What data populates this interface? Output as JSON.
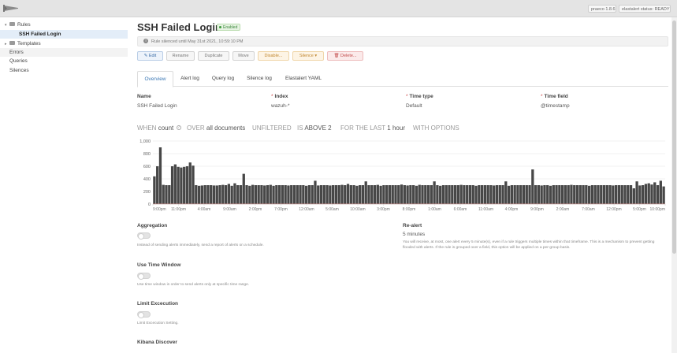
{
  "app": {
    "version_badge": "praeco 1.8.6",
    "status_badge": "elastalert status: READY"
  },
  "sidebar": {
    "items": [
      {
        "label": "Rules",
        "type": "folder",
        "expanded": true
      },
      {
        "label": "SSH Failed Login",
        "type": "rule",
        "selected": true
      },
      {
        "label": "Templates",
        "type": "folder",
        "expanded": false
      },
      {
        "label": "Errors",
        "type": "link"
      },
      {
        "label": "Queries",
        "type": "link"
      },
      {
        "label": "Silences",
        "type": "link"
      }
    ]
  },
  "rule": {
    "title": "SSH Failed Login",
    "status": "Enabled",
    "notice": "Rule silenced until May 31st 2021, 10:59:10 PM"
  },
  "actions": {
    "edit": "Edit",
    "rename": "Rename",
    "duplicate": "Duplicate",
    "move": "Move",
    "disable": "Disable...",
    "silence": "Silence",
    "delete": "Delete..."
  },
  "tabs": [
    "Overview",
    "Alert log",
    "Query log",
    "Silence log",
    "Elastalert YAML"
  ],
  "fields": [
    {
      "label": "Name",
      "required": false,
      "value": "SSH Failed Login"
    },
    {
      "label": "Index",
      "required": true,
      "value": "wazuh-*"
    },
    {
      "label": "Time type",
      "required": true,
      "value": "Default"
    },
    {
      "label": "Time field",
      "required": true,
      "value": "@timestamp"
    }
  ],
  "when": {
    "when_label": "WHEN",
    "when_value": "count",
    "over_label": "OVER",
    "over_value": "all documents",
    "filter": "UNFILTERED",
    "is_label": "IS",
    "is_value": "ABOVE 2",
    "for_label": "FOR THE LAST",
    "for_value": "1 hour",
    "options": "WITH OPTIONS"
  },
  "chart_data": {
    "type": "bar",
    "ylim": [
      0,
      1000
    ],
    "y_ticks": [
      "1,000",
      "800",
      "600",
      "400",
      "200",
      "0"
    ],
    "x_tick_labels": [
      "9:00pm",
      "11:00pm",
      "4:00am",
      "9:00am",
      "2:00pm",
      "7:00pm",
      "12:00am",
      "5:00am",
      "10:00am",
      "3:00pm",
      "8:00pm",
      "1:00am",
      "6:00am",
      "11:00am",
      "4:00pm",
      "9:00pm",
      "2:00am",
      "7:00am",
      "12:00pm",
      "5:00pm",
      "10:00pm"
    ],
    "threshold": 2,
    "values": [
      440,
      600,
      900,
      305,
      300,
      300,
      600,
      630,
      590,
      580,
      590,
      600,
      660,
      610,
      300,
      290,
      295,
      300,
      300,
      300,
      295,
      295,
      300,
      305,
      300,
      320,
      290,
      330,
      300,
      300,
      480,
      300,
      290,
      305,
      300,
      300,
      300,
      295,
      300,
      305,
      290,
      300,
      300,
      300,
      300,
      295,
      300,
      300,
      300,
      300,
      300,
      290,
      300,
      300,
      370,
      295,
      300,
      300,
      300,
      295,
      300,
      300,
      300,
      305,
      300,
      320,
      300,
      300,
      290,
      300,
      300,
      360,
      300,
      300,
      300,
      305,
      290,
      300,
      300,
      300,
      300,
      300,
      300,
      310,
      300,
      295,
      300,
      300,
      290,
      305,
      300,
      300,
      300,
      300,
      360,
      300,
      290,
      300,
      300,
      300,
      300,
      300,
      300,
      305,
      300,
      300,
      300,
      300,
      290,
      300,
      300,
      300,
      300,
      300,
      295,
      300,
      300,
      300,
      360,
      290,
      300,
      300,
      300,
      300,
      300,
      300,
      300,
      550,
      300,
      300,
      295,
      300,
      300,
      290,
      300,
      300,
      300,
      300,
      300,
      300,
      305,
      300,
      300,
      300,
      300,
      300,
      290,
      300,
      300,
      300,
      300,
      300,
      300,
      300,
      295,
      300,
      300,
      300,
      300,
      300,
      300,
      250,
      360,
      295,
      300,
      320,
      330,
      310,
      345,
      300,
      370,
      280
    ]
  },
  "sections": {
    "aggregation": {
      "title": "Aggregation",
      "desc": "Instead of sending alerts immediately, send a report of alerts on a schedule."
    },
    "use_time_window": {
      "title": "Use Time Window",
      "desc": "Use time window in order to send alerts only at specific time range."
    },
    "limit_execution": {
      "title": "Limit Excecution",
      "desc": "Limit Excecution Setting."
    },
    "kibana_discover": {
      "title": "Kibana Discover"
    },
    "realert": {
      "title": "Re-alert",
      "value": "5 minutes",
      "desc": "You will receive, at most, one alert every 5 minute(s), even if a rule triggers multiple times within that timeframe. This is a mechanism to prevent getting flooded with alerts. If the rule is grouped over a field, this option will be applied on a per-group basis."
    }
  },
  "colors": {
    "bar": "#474747",
    "threshold": "#d9534f",
    "link": "#3b78b5",
    "selected_bg": "#e3edf8"
  }
}
